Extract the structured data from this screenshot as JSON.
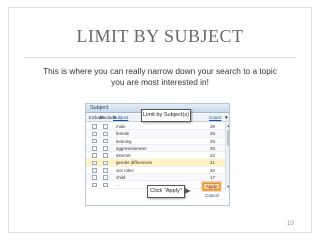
{
  "slide": {
    "title": "LIMIT BY SUBJECT",
    "subtitle": "This is where you can really narrow down your search to a topic you are most interested in!",
    "page_number": "10"
  },
  "dialog": {
    "header_label": "Subject",
    "columns": {
      "include": "Include",
      "exclude": "Exclude",
      "subject": "Subject",
      "count": "Count"
    },
    "rows": [
      {
        "name": "male",
        "count": "29"
      },
      {
        "name": "female",
        "count": "29"
      },
      {
        "name": "learning",
        "count": "29"
      },
      {
        "name": "aggressiveness",
        "count": "25"
      },
      {
        "name": "internet",
        "count": "22"
      },
      {
        "name": "gender differences",
        "count": "21"
      },
      {
        "name": "sex roles",
        "count": "20"
      },
      {
        "name": "child",
        "count": "17"
      },
      {
        "name": "...",
        "count": "17"
      }
    ],
    "highlighted_row_index": 5,
    "apply_label": "Apply",
    "cancel_label": "Cancel"
  },
  "callouts": {
    "top": "Limit by Subject(s)",
    "bottom": "Click \"Apply\""
  },
  "colors": {
    "title": "#6b6864",
    "dialog_header": "#c9d9e9",
    "highlight_row": "#fff3c6",
    "apply_button": "#fbd7b2"
  },
  "icons": [
    "checkbox-icon",
    "sort-down-icon",
    "scroll-up-icon",
    "scroll-down-icon"
  ]
}
